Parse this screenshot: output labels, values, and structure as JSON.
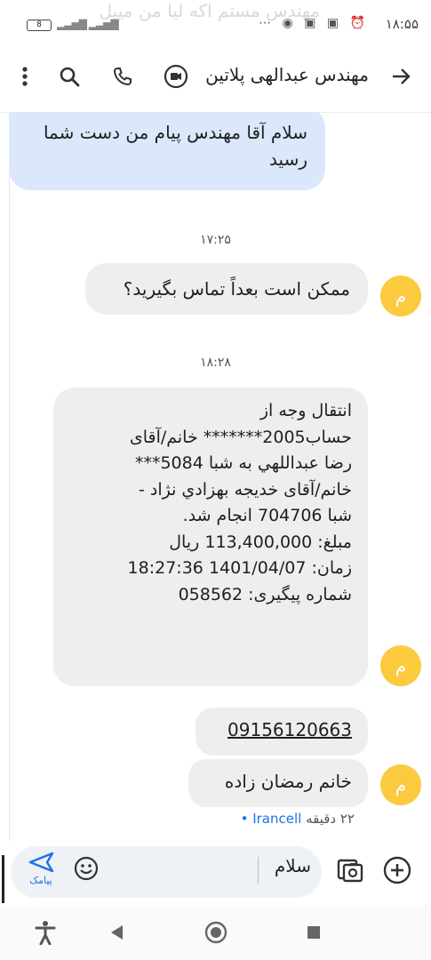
{
  "status_bar": {
    "time": "۱۸:۵۵",
    "notification_ghost_text": "مهندس مستم اکه لیا من مییل",
    "battery_level": "8"
  },
  "header": {
    "contact_name": "مهندس عبدالهی پلاتین"
  },
  "messages": [
    {
      "type": "sent",
      "text": "سلام آقا مهندس پیام من دست شما رسید"
    },
    {
      "type": "timestamp",
      "text": "۱۷:۲۵"
    },
    {
      "type": "received",
      "avatar_letter": "م",
      "text": "ممکن است بعداً تماس بگیرید؟"
    },
    {
      "type": "timestamp",
      "text": "۱۸:۲۸"
    },
    {
      "type": "received",
      "avatar_letter": "م",
      "lines": [
        "انتقال وجه از",
        "حساب2005******* خانم/آقای",
        "رضا عبداللهي به شبا 5084***",
        "خانم/آقای خديجه بهزادي نژاد -",
        "شبا 704706 انجام شد.",
        "مبلغ: 113,400,000 ریال",
        "زمان: 1401/04/07   18:27:36",
        "شماره پیگیری: 058562"
      ]
    },
    {
      "type": "received",
      "text": "09156120663"
    },
    {
      "type": "received",
      "avatar_letter": "م",
      "text": "خانم رمضان زاده"
    }
  ],
  "message_meta": {
    "elapsed": "۲۲ دقیقه",
    "carrier": "Irancell"
  },
  "compose": {
    "input_value": "سلام",
    "send_label": "پیامک"
  },
  "colors": {
    "accent": "#1a73e8",
    "sent_bubble": "#dbe7fb",
    "received_bubble": "#eeeeee",
    "avatar": "#fcca3f"
  }
}
